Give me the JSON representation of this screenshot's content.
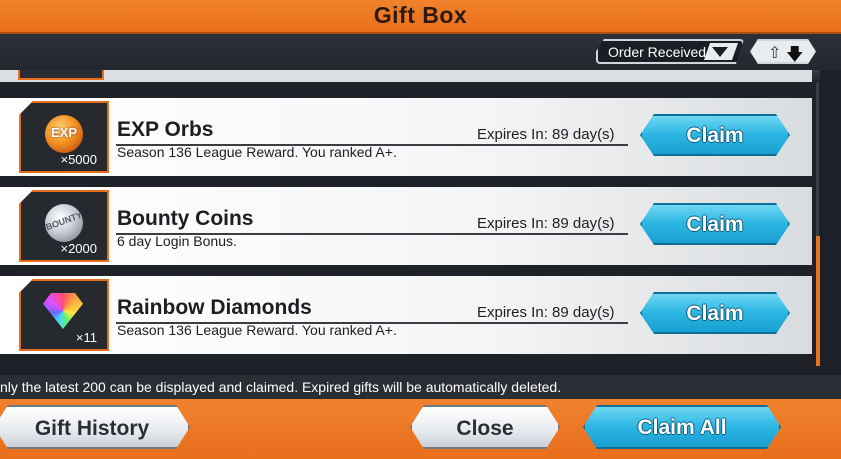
{
  "header": {
    "title": "Gift Box"
  },
  "sort": {
    "selected": "Order Received",
    "chevron_icon": "chevron-down-icon",
    "order_icons": [
      "arrow-up-icon",
      "arrow-down-icon"
    ]
  },
  "gifts": [
    {
      "name": "EXP Orbs",
      "icon": "exp-orb-icon",
      "icon_text": "EXP",
      "quantity": "×5000",
      "description": "Season 136 League Reward. You ranked A+.",
      "expires": "Expires In: 89 day(s)",
      "claim_label": "Claim"
    },
    {
      "name": "Bounty Coins",
      "icon": "bounty-coin-icon",
      "icon_text": "BOUNTY",
      "quantity": "×2000",
      "description": "6 day Login Bonus.",
      "expires": "Expires In: 89 day(s)",
      "claim_label": "Claim"
    },
    {
      "name": "Rainbow Diamonds",
      "icon": "rainbow-diamond-icon",
      "icon_text": "",
      "quantity": "×11",
      "description": "Season 136 League Reward. You ranked A+.",
      "expires": "Expires In: 89 day(s)",
      "claim_label": "Claim"
    }
  ],
  "notice": "nly the latest 200 can be displayed and claimed. Expired gifts will be automatically deleted.",
  "footer": {
    "gift_history": "Gift History",
    "close": "Close",
    "claim_all": "Claim All"
  },
  "colors": {
    "accent_orange": "#e86e1c",
    "claim_blue": "#2bb5e3",
    "panel_dark": "#1e2228"
  }
}
